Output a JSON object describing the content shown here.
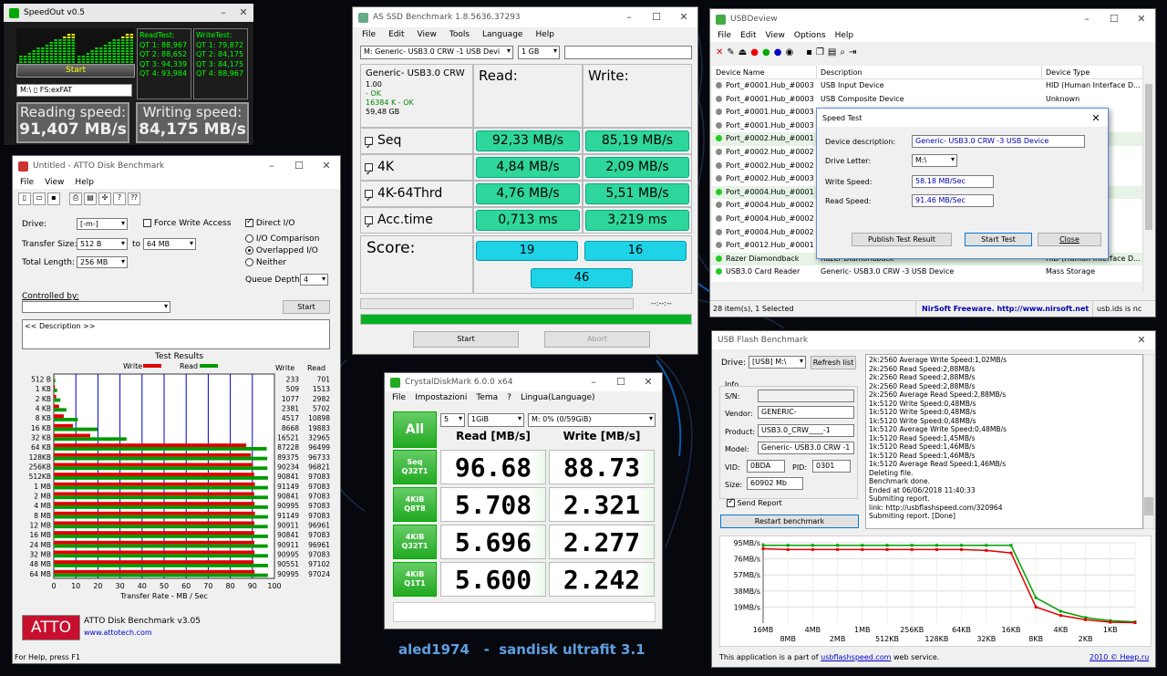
{
  "caption": "aled1974   -  sandisk ultrafit 3.1",
  "speedout": {
    "title": "SpeedOut v0.5",
    "start": "Start",
    "drive": "M:\\ ▯ FS:exFAT",
    "readtest": [
      "ReadTest:",
      "QT 1: 88,967",
      "QT 2: 88,652",
      "QT 3: 94,339",
      "QT 4: 93,984"
    ],
    "writetest": [
      "WriteTest:",
      "QT 1: 79,872",
      "QT 2: 84,175",
      "QT 3: 84,175",
      "QT 4: 88,967"
    ],
    "reading_label": "Reading speed:",
    "reading_value": "91,407 MB/s",
    "writing_label": "Writing speed:",
    "writing_value": "84,175 MB/s"
  },
  "atto": {
    "title": "Untitled - ATTO Disk Benchmark",
    "menu": [
      "File",
      "View",
      "Help"
    ],
    "drive_label": "Drive:",
    "drive": "[-m-]",
    "transfer_label": "Transfer Size:",
    "ts_from": "512 B",
    "to": "to",
    "ts_to": "64 MB",
    "total_label": "Total Length:",
    "total": "256 MB",
    "force": "Force Write Access",
    "direct": "Direct I/O",
    "io_comp": "I/O Comparison",
    "overlapped": "Overlapped I/O",
    "neither": "Neither",
    "queue_label": "Queue Depth:",
    "queue": "4",
    "controlled": "Controlled by:",
    "start": "Start",
    "description": "<< Description >>",
    "test_results": "Test Results",
    "write": "Write",
    "read": "Read",
    "xticks": [
      "0",
      "10",
      "20",
      "30",
      "40",
      "50",
      "60",
      "70",
      "80",
      "90",
      "100"
    ],
    "xlabel": "Transfer Rate - MB / Sec",
    "brand": "ATTO",
    "product": "ATTO Disk Benchmark v3.05",
    "url": "www.attotech.com",
    "status": "For Help, press F1"
  },
  "chart_data": {
    "type": "bar",
    "title": "Test Results",
    "xlabel": "Transfer Rate - MB / Sec",
    "xlim": [
      0,
      100
    ],
    "categories": [
      "512 B",
      "1 KB",
      "2 KB",
      "4 KB",
      "8 KB",
      "16 KB",
      "32 KB",
      "64 KB",
      "128KB",
      "256KB",
      "512KB",
      "1 MB",
      "2 MB",
      "4 MB",
      "8 MB",
      "12 MB",
      "16 MB",
      "24 MB",
      "32 MB",
      "48 MB",
      "64 MB"
    ],
    "series": [
      {
        "name": "Write",
        "color": "#e00000",
        "values": [
          0.233,
          0.509,
          1.077,
          2.381,
          4.517,
          8.668,
          16.521,
          87.228,
          89.375,
          90.234,
          90.841,
          91.149,
          90.841,
          90.995,
          91.149,
          90.911,
          90.841,
          90.911,
          90.995,
          90.551,
          90.995
        ],
        "labels": [
          "233",
          "509",
          "1077",
          "2381",
          "4517",
          "8668",
          "16521",
          "87228",
          "89375",
          "90234",
          "90841",
          "91149",
          "90841",
          "90995",
          "91149",
          "90911",
          "90841",
          "90911",
          "90995",
          "90551",
          "90995"
        ]
      },
      {
        "name": "Read",
        "color": "#009a00",
        "values": [
          0.701,
          1.513,
          2.982,
          5.702,
          10.898,
          19.883,
          32.965,
          96.499,
          96.733,
          96.821,
          97.083,
          97.083,
          97.083,
          97.083,
          97.083,
          96.961,
          97.083,
          96.961,
          97.083,
          97.102,
          97.024
        ],
        "labels": [
          "701",
          "1513",
          "2982",
          "5702",
          "10898",
          "19883",
          "32965",
          "96499",
          "96733",
          "96821",
          "97083",
          "97083",
          "97083",
          "97083",
          "97083",
          "96961",
          "97083",
          "96961",
          "97083",
          "97102",
          "97024"
        ]
      }
    ]
  },
  "asssd": {
    "title": "AS SSD Benchmark 1.8.5636.37293",
    "menu": [
      "File",
      "Edit",
      "View",
      "Tools",
      "Language",
      "Help"
    ],
    "drive": "M: Generic- USB3.0 CRW  -1 USB Devi",
    "size": "1 GB",
    "info": [
      "Generic- USB3.0 CRW",
      "1.00",
      " - OK",
      "16384 K - OK",
      "59,48 GB"
    ],
    "read": "Read:",
    "write": "Write:",
    "rows": [
      {
        "label": "Seq",
        "r": "92,33 MB/s",
        "w": "85,19 MB/s"
      },
      {
        "label": "4K",
        "r": "4,84 MB/s",
        "w": "2,09 MB/s"
      },
      {
        "label": "4K-64Thrd",
        "r": "4,76 MB/s",
        "w": "5,51 MB/s"
      },
      {
        "label": "Acc.time",
        "r": "0,713 ms",
        "w": "3,219 ms"
      }
    ],
    "score": "Score:",
    "score_r": "19",
    "score_w": "16",
    "score_t": "46",
    "time": "--:--:--",
    "start": "Start",
    "abort": "Abort"
  },
  "cdm": {
    "title": "CrystalDiskMark 6.0.0 x64",
    "menu": [
      "File",
      "Impostazioni",
      "Tema",
      "?",
      "Lingua(Language)"
    ],
    "all": "All",
    "count": "5",
    "size": "1GiB",
    "drive": "M: 0% (0/59GiB)",
    "read_h": "Read [MB/s]",
    "write_h": "Write [MB/s]",
    "rows": [
      {
        "l1": "Seq",
        "l2": "Q32T1",
        "r": "96.68",
        "w": "88.73"
      },
      {
        "l1": "4KiB",
        "l2": "Q8T8",
        "r": "5.708",
        "w": "2.321"
      },
      {
        "l1": "4KiB",
        "l2": "Q32T1",
        "r": "5.696",
        "w": "2.277"
      },
      {
        "l1": "4KiB",
        "l2": "Q1T1",
        "r": "5.600",
        "w": "2.242"
      }
    ]
  },
  "usbdev": {
    "title": "USBDeview",
    "menu": [
      "File",
      "Edit",
      "View",
      "Options",
      "Help"
    ],
    "col_name": "Device Name",
    "col_desc": "Description",
    "col_type": "Device Type",
    "rows": [
      {
        "n": "Port_#0001.Hub_#0003",
        "d": "USB Input Device",
        "t": "HID (Human Interface D...",
        "c": "#888"
      },
      {
        "n": "Port_#0001.Hub_#0003",
        "d": "USB Composite Device",
        "t": "Unknown",
        "c": "#888"
      },
      {
        "n": "Port_#0001.Hub_#0003",
        "d": "",
        "t": "",
        "c": "#888"
      },
      {
        "n": "Port_#0001.Hub_#0003",
        "d": "",
        "t": "",
        "c": "#888"
      },
      {
        "n": "Port_#0002.Hub_#0001",
        "d": "",
        "t": "",
        "c": "#2c2"
      },
      {
        "n": "Port_#0002.Hub_#0002",
        "d": "",
        "t": "",
        "c": "#888"
      },
      {
        "n": "Port_#0002.Hub_#0002",
        "d": "",
        "t": "",
        "c": "#888"
      },
      {
        "n": "Port_#0002.Hub_#0003",
        "d": "",
        "t": "",
        "c": "#888"
      },
      {
        "n": "Port_#0004.Hub_#0001",
        "d": "",
        "t": "",
        "c": "#2c2"
      },
      {
        "n": "Port_#0004.Hub_#0002",
        "d": "",
        "t": "",
        "c": "#888"
      },
      {
        "n": "Port_#0004.Hub_#0002",
        "d": "",
        "t": "",
        "c": "#888"
      },
      {
        "n": "Port_#0004.Hub_#0002",
        "d": "",
        "t": "",
        "c": "#888"
      },
      {
        "n": "Port_#0012.Hub_#0001",
        "d": "",
        "t": "",
        "c": "#888"
      },
      {
        "n": "Razer Diamondback",
        "d": "Razer Diamondback",
        "t": "HID (Human Interface D...",
        "c": "#2c2"
      },
      {
        "n": "USB3.0 Card Reader",
        "d": "Generic- USB3.0 CRW   -3 USB Device",
        "t": "Mass Storage",
        "c": "#2c2"
      }
    ],
    "status1": "28 item(s), 1 Selected",
    "status2": "NirSoft Freeware.  http://www.nirsoft.net",
    "status3": "usb.ids is nc",
    "dlg": {
      "title": "Speed Test",
      "desc_label": "Device description:",
      "desc": "Generic- USB3.0 CRW   -3 USB Device",
      "letter_label": "Drive Letter:",
      "letter": "M:\\",
      "ws_label": "Write Speed:",
      "ws": "58.18  MB/Sec",
      "rs_label": "Read Speed:",
      "rs": "91.46  MB/Sec",
      "publish": "Publish Test Result",
      "start": "Start Test",
      "close": "Close"
    }
  },
  "ufb": {
    "title": "USB Flash Benchmark",
    "drive_label": "Drive:",
    "drive": "[USB] M:\\",
    "refresh": "Refresh list",
    "info": "Info",
    "sn_label": "S/N:",
    "sn": "",
    "vendor_label": "Vendor:",
    "vendor": "GENERIC-",
    "product_label": "Product:",
    "product": "USB3.0_CRW____-1",
    "model_label": "Model:",
    "model": "Generic- USB3.0 CRW   -1",
    "vid_label": "VID:",
    "vid": "0BDA",
    "pid_label": "PID:",
    "pid": "0301",
    "size_label": "Size:",
    "size": "60902 Mb",
    "send": "Send Report",
    "restart": "Restart benchmark",
    "log": [
      "2k:2560 Average Write Speed:1,02MB/s",
      "2k:2560 Read Speed:2,88MB/s",
      "2k:2560 Read Speed:2,88MB/s",
      "2k:2560 Read Speed:2,88MB/s",
      "2k:2560 Average Read Speed:2,88MB/s",
      "1k:5120 Write Speed:0,48MB/s",
      "1k:5120 Write Speed:0,48MB/s",
      "1k:5120 Write Speed:0,48MB/s",
      "1k:5120 Average Write Speed:0,48MB/s",
      "1k:5120 Read Speed:1,45MB/s",
      "1k:5120 Read Speed:1,46MB/s",
      "1k:5120 Read Speed:1,46MB/s",
      "1k:5120 Average Read Speed:1,46MB/s",
      "Deleting file.",
      "Benchmark done.",
      "Ended at 06/06/2018 11:40:33",
      "Submiting report.",
      "link: http://usbflashspeed.com/320964",
      "Submiting report. [Done]"
    ],
    "yticks": [
      "95MB/s",
      "76MB/s",
      "57MB/s",
      "38MB/s",
      "19MB/s"
    ],
    "xticks_top": [
      "16MB",
      "4MB",
      "1MB",
      "256KB",
      "64KB",
      "16KB",
      "4KB",
      "1KB"
    ],
    "xticks_bot": [
      "8MB",
      "2MB",
      "512KB",
      "128KB",
      "32KB",
      "8KB",
      "2KB"
    ],
    "footer1": "This application is a part of ",
    "footer_link": "usbflashspeed.com",
    "footer2": " web service.",
    "footer_right": "2010 © Heep.ru",
    "read_line": [
      92,
      92,
      92,
      92,
      92,
      92,
      92,
      92,
      92,
      92,
      92,
      30,
      14,
      6.5,
      2.88,
      1.46
    ],
    "write_line": [
      88,
      87,
      87,
      87,
      87,
      87,
      87,
      87,
      87,
      86,
      83,
      19,
      9,
      4,
      1.02,
      0.48
    ],
    "series_colors": {
      "read": "#00a000",
      "write": "#e00000"
    }
  }
}
